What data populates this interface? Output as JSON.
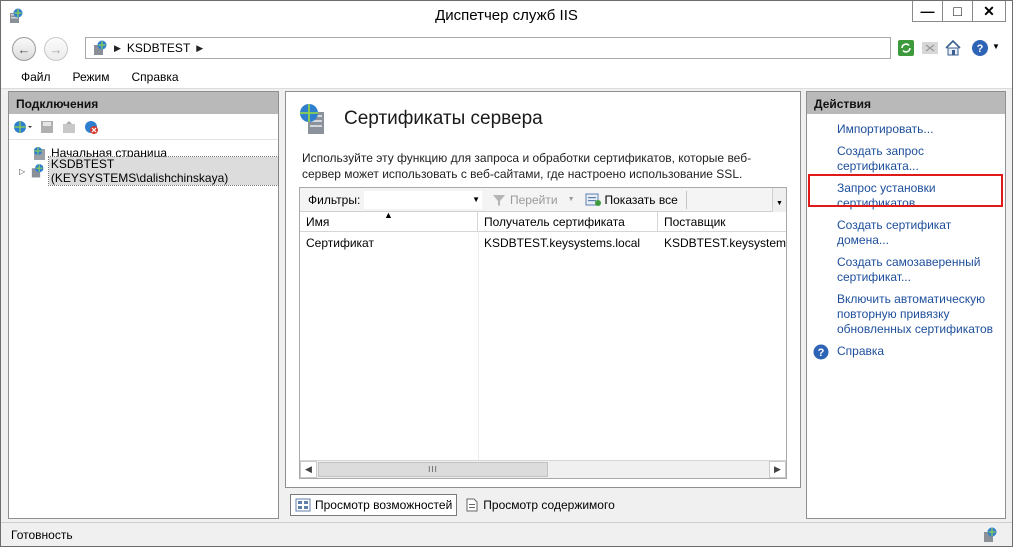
{
  "window": {
    "title": "Диспетчер служб IIS",
    "controls": [
      "—",
      "□",
      "✕"
    ]
  },
  "address": {
    "crumb": "KSDBTEST"
  },
  "menu": {
    "items": [
      "Файл",
      "Режим",
      "Справка"
    ]
  },
  "connections": {
    "header": "Подключения",
    "tree": [
      {
        "label": "Начальная страница",
        "icon": "start-page-icon"
      },
      {
        "label": "KSDBTEST (KEYSYSTEMS\\dalishchinskaya)",
        "icon": "server-icon",
        "selected": true
      }
    ]
  },
  "main": {
    "title": "Сертификаты сервера",
    "description": "Используйте эту функцию для запроса и обработки сертификатов, которые веб-сервер может использовать с веб-сайтами, где настроено использование SSL.",
    "filters": {
      "label": "Фильтры:",
      "go": "Перейти",
      "show_all": "Показать все"
    },
    "columns": [
      "Имя",
      "Получатель сертификата",
      "Поставщик"
    ],
    "rows": [
      [
        "Сертификат",
        "KSDBTEST.keysystems.local",
        "KSDBTEST.keysystems."
      ]
    ],
    "scroll_thumb": "III"
  },
  "views": {
    "features": "Просмотр возможностей",
    "content": "Просмотр содержимого"
  },
  "actions": {
    "header": "Действия",
    "items": [
      "Импортировать...",
      "Создать запрос сертификата...",
      "Запрос установки сертификатов...",
      "Создать сертификат домена...",
      "Создать самозаверенный сертификат...",
      "Включить автоматическую повторную привязку обновленных сертификатов",
      "Справка"
    ]
  },
  "status": {
    "text": "Готовность"
  },
  "colors": {
    "link": "#1d4e9b",
    "panel_header": "#b9b9b9",
    "highlight": "#e01919"
  }
}
